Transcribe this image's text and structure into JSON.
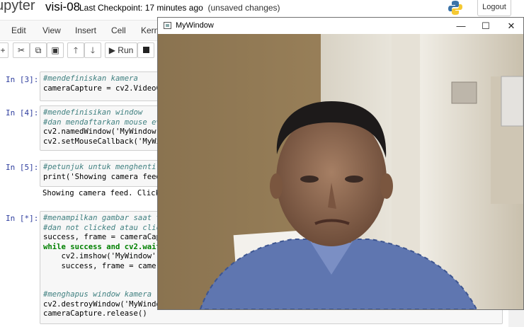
{
  "header": {
    "logo": "upyter",
    "notebook_name": "visi-08",
    "checkpoint_label": "Last Checkpoint:",
    "checkpoint_time": "17 minutes ago",
    "unsaved": "(unsaved changes)",
    "logout": "Logout"
  },
  "menu": {
    "items": [
      "Edit",
      "View",
      "Insert",
      "Cell",
      "Kern"
    ]
  },
  "toolbar": {
    "run_label": "Run"
  },
  "cells": [
    {
      "prompt": "In [3]:",
      "lines": [
        "#mendefiniskan kamera",
        "cameraCapture = cv2.VideoC"
      ]
    },
    {
      "prompt": "In [4]:",
      "lines": [
        "#mendefinisikan window",
        "#dan mendaftarkan mouse ev",
        "cv2.namedWindow('MyWindow'",
        "cv2.setMouseCallback('MyWi"
      ]
    },
    {
      "prompt": "In [5]:",
      "lines": [
        "#petunjuk untuk menghenti",
        "print('Showing camera feed"
      ],
      "output": "Showing camera feed. Click"
    },
    {
      "prompt": "In [*]:",
      "lines": [
        "#menampilkan gambar saat t",
        "#dan not clicked atau clic",
        "success, frame = cameraCap",
        "while success and cv2.wait",
        "    cv2.imshow('MyWindow'",
        "    success, frame = came",
        "",
        "",
        "#menghapus window kamera",
        "cv2.destroyWindow('MyWindo",
        "cameraCapture.release()"
      ]
    }
  ],
  "cv_window": {
    "title": "MyWindow",
    "minimize": "—",
    "maximize": "☐",
    "close": "✕"
  },
  "colors": {
    "prompt": "#303f9f",
    "comment": "#408080",
    "string": "#ba2121",
    "keyword": "#008000",
    "cell_bg": "#f7f7f7"
  }
}
